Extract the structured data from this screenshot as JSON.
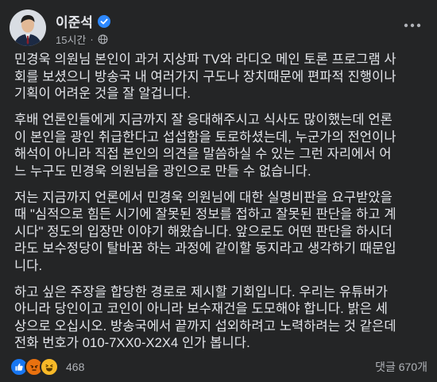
{
  "post": {
    "author_name": "이준석",
    "time": "15시간",
    "separator": "·",
    "paragraphs": [
      "민경욱 의원님 본인이 과거 지상파 TV와 라디오 메인 토론 프로그램 사\n회를 보셨으니 방송국 내 여러가지 구도나 장치때문에 편파적 진행이나\n기획이 어려운 것을 잘 알겁니다.",
      "후배 언론인들에게 지금까지 잘 응대해주시고 식사도 많이했는데 언론\n이 본인을 광인 취급한다고 섭섭함을 토로하셨는데, 누군가의 전언이나\n해석이 아니라 직접 본인의 의견을 말씀하실 수 있는 그런 자리에서 어\n느 누구도 민경욱 의원님을 광인으로 만들 수 없습니다.",
      "저는 지금까지 언론에서 민경욱 의원님에 대한 실명비판을 요구받았을\n때 \"심적으로 힘든 시기에 잘못된 정보를 접하고 잘못된 판단을 하고 계\n시다\" 정도의 입장만 이야기 해왔습니다. 앞으로도 어떤 판단을 하시더\n라도 보수정당이 탈바꿈 하는 과정에 같이할 동지라고 생각하기 때문입\n니다.",
      "하고 싶은 주장을 합당한 경로로 제시할 기회입니다. 우리는 유튜버가\n아니라 당인이고 코인이 아니라 보수재건을 도모해야 합니다. 밝은 세\n상으로 오십시오. 방송국에서 끝까지 섭외하려고 노력하려는 것 같은데\n전화 번호가 010-7XX0-X2X4 인가 봅니다."
    ],
    "reaction_count": "468",
    "comment_count": "댓글 670개"
  },
  "icons": {
    "verified": "verified-badge-icon",
    "privacy": "globe-icon",
    "more": "more-options-icon",
    "reactions": [
      "like-icon",
      "angry-icon",
      "haha-icon"
    ]
  },
  "colors": {
    "background": "#242526",
    "text_primary": "#e4e6eb",
    "text_secondary": "#b0b3b8",
    "verified_blue": "#2d88ff",
    "like_blue": "#1877f2",
    "angry_orange": "#e9710f",
    "haha_yellow": "#f7b928"
  }
}
